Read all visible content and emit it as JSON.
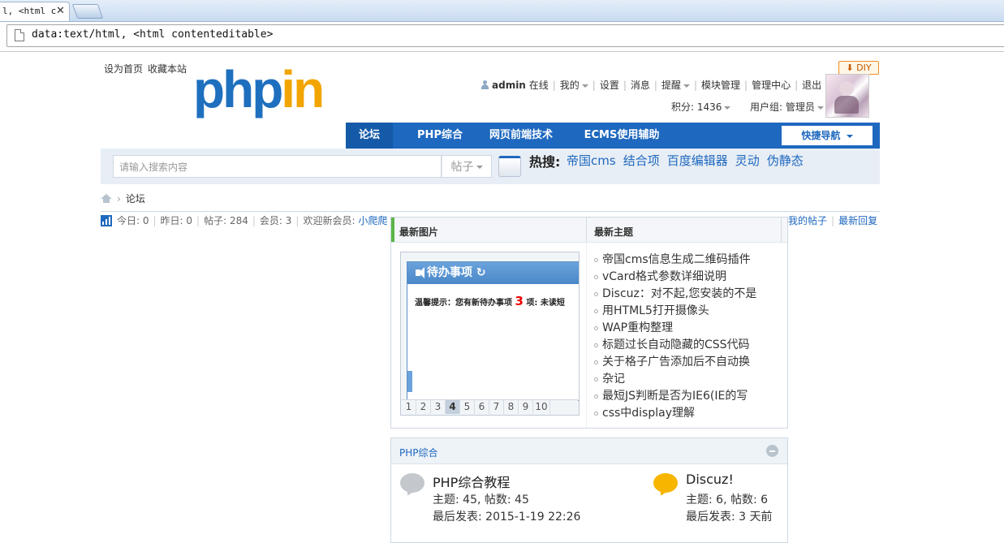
{
  "browser": {
    "tab_title": "l, <html c",
    "tab_close": "✕",
    "url": "data:text/html, <html contenteditable>"
  },
  "header": {
    "links": [
      "设为首页",
      "收藏本站"
    ],
    "logo_part1": "php",
    "logo_part2": "in",
    "diy_label": "DIY",
    "diy_arrow": "⬇"
  },
  "userbar": {
    "username": "admin",
    "status": "在线",
    "my": "我的",
    "settings": "设置",
    "messages": "消息",
    "reminders": "提醒",
    "module_mgmt": "模块管理",
    "admin_center": "管理中心",
    "logout": "退出",
    "credits_label": "积分: 1436",
    "usergroup_label": "用户组: 管理员"
  },
  "nav": {
    "items": [
      "论坛",
      "PHP综合",
      "网页前端技术",
      "ECMS使用辅助"
    ],
    "quick_nav": "快捷导航"
  },
  "search": {
    "placeholder": "请输入搜索内容",
    "type": "帖子",
    "hot_label": "热搜:",
    "hot_terms": [
      "帝国cms",
      "结合项",
      "百度编辑器",
      "灵动",
      "伪静态"
    ]
  },
  "breadcrumb": {
    "current": "论坛",
    "arrow": "›"
  },
  "stats": {
    "today": "今日: 0",
    "yesterday": "昨日: 0",
    "posts": "帖子: 284",
    "members": "会员: 3",
    "welcome": "欢迎新会员:",
    "newest_member": "小爬爬",
    "my_posts": "我的帖子",
    "latest_replies": "最新回复"
  },
  "panel": {
    "latest_images": "最新图片",
    "latest_topics": "最新主题",
    "slide_title": "待办事项",
    "slide_refresh": "↻",
    "slide_tip_before": "温馨提示：您有新待办事项",
    "slide_tip_num": "3",
    "slide_tip_after": "项: 未读短",
    "pages": [
      "1",
      "2",
      "3",
      "4",
      "5",
      "6",
      "7",
      "8",
      "9",
      "10"
    ],
    "active_page": "4",
    "topics": [
      "帝国cms信息生成二维码插件",
      "vCard格式参数详细说明",
      "Discuz：对不起,您安装的不是",
      "用HTML5打开摄像头",
      "WAP重构整理",
      "标题过长自动隐藏的CSS代码",
      "关于格子广告添加后不自动换",
      "杂记",
      "最短JS判断是否为IE6(IE的写",
      "css中display理解"
    ]
  },
  "category": {
    "title": "PHP综合",
    "forums": [
      {
        "name": "PHP综合教程",
        "stats": "主题: 45, 帖数: 45",
        "last": "最后发表: 2015-1-19 22:26",
        "icon": "gray"
      },
      {
        "name": "Discuz!",
        "stats": "主题: 6, 帖数: 6",
        "last": "最后发表: 3 天前",
        "icon": "orange"
      }
    ]
  }
}
